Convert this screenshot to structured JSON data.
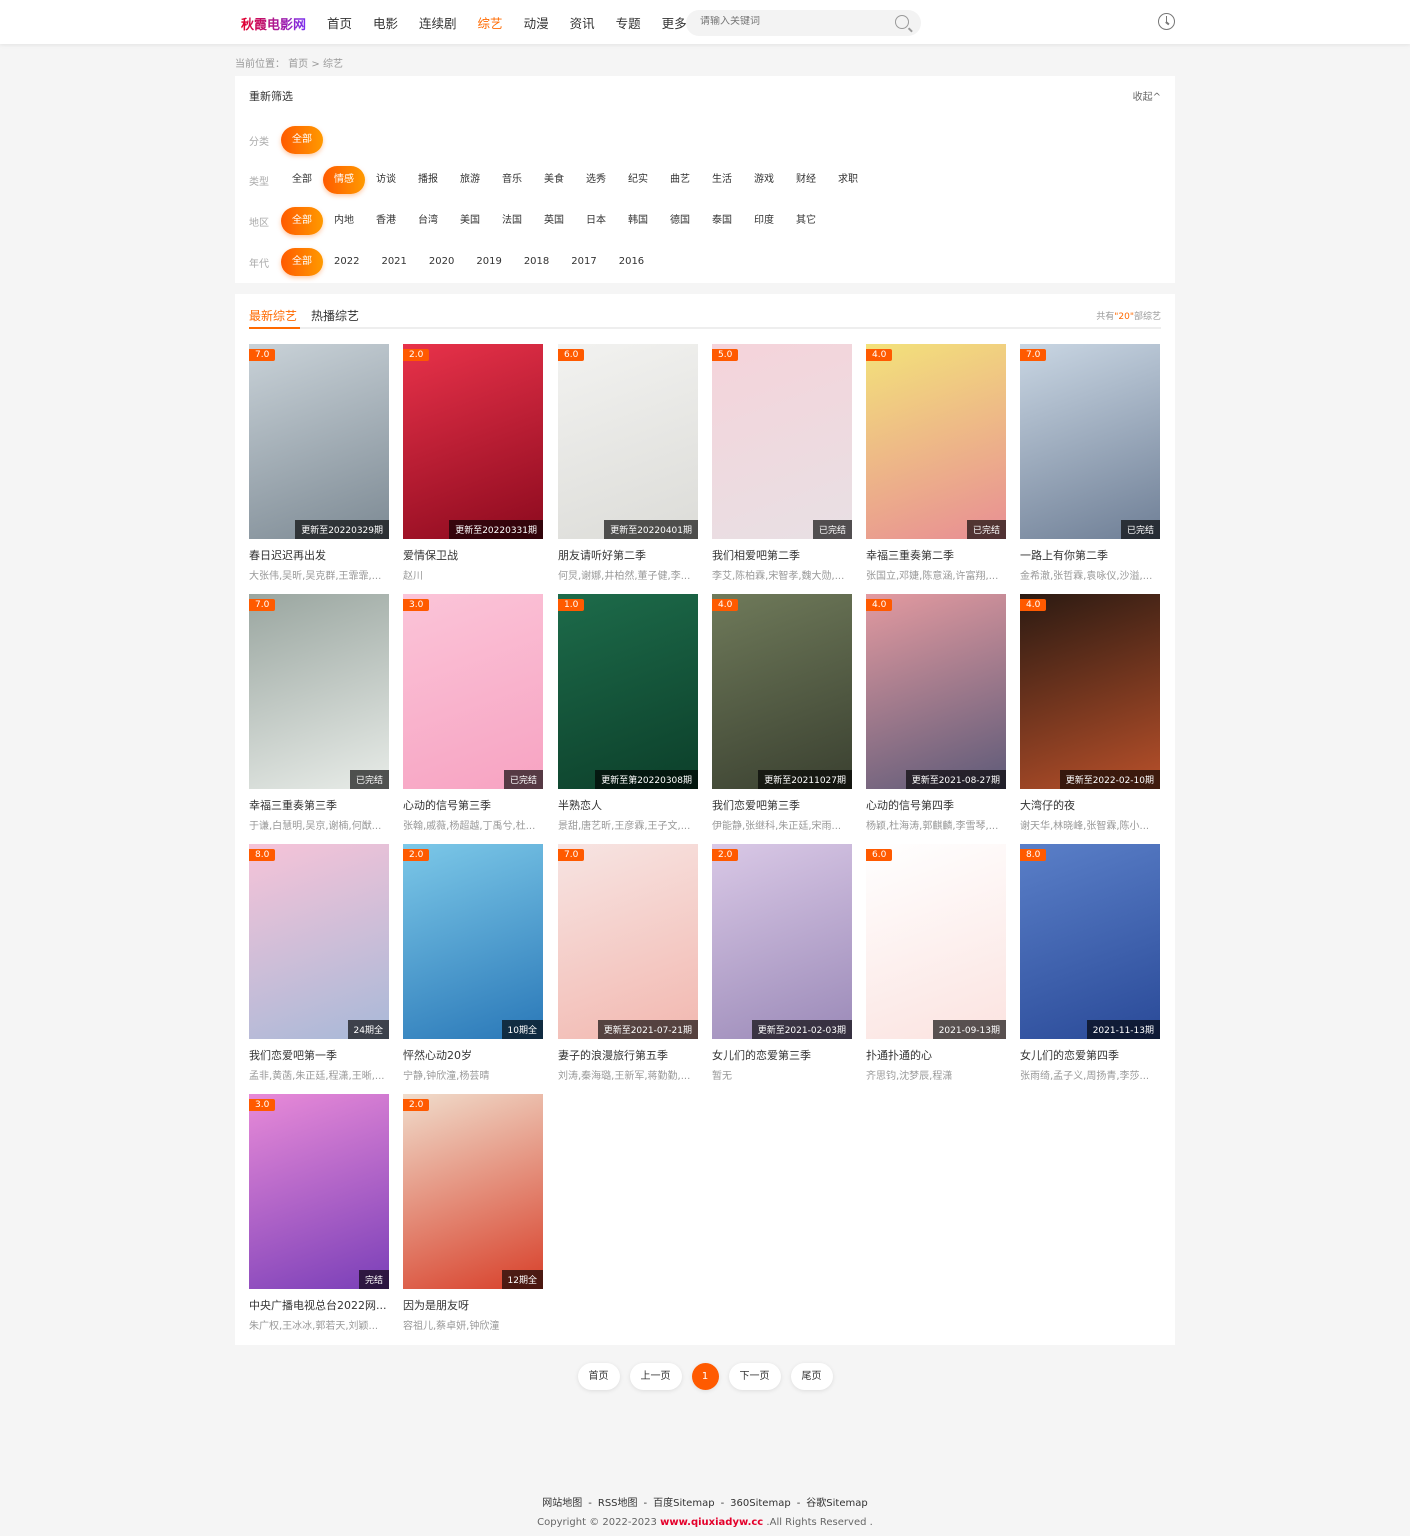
{
  "header": {
    "logo": "秋霞电影网",
    "nav": [
      "首页",
      "电影",
      "连续剧",
      "综艺",
      "动漫",
      "资讯",
      "专题",
      "更多"
    ],
    "active_nav": 3,
    "search_placeholder": "请输入关键词"
  },
  "breadcrumb": {
    "label": "当前位置：",
    "home": "首页",
    "sep": ">",
    "current": "综艺"
  },
  "filter": {
    "title": "重新筛选",
    "collapse": "收起^",
    "rows": [
      {
        "label": "分类",
        "options": [
          "全部"
        ],
        "selected": 0
      },
      {
        "label": "类型",
        "options": [
          "全部",
          "情感",
          "访谈",
          "播报",
          "旅游",
          "音乐",
          "美食",
          "选秀",
          "纪实",
          "曲艺",
          "生活",
          "游戏",
          "财经",
          "求职"
        ],
        "selected": 1
      },
      {
        "label": "地区",
        "options": [
          "全部",
          "内地",
          "香港",
          "台湾",
          "美国",
          "法国",
          "英国",
          "日本",
          "韩国",
          "德国",
          "泰国",
          "印度",
          "其它"
        ],
        "selected": 0
      },
      {
        "label": "年代",
        "options": [
          "全部",
          "2022",
          "2021",
          "2020",
          "2019",
          "2018",
          "2017",
          "2016"
        ],
        "selected": 0
      }
    ]
  },
  "list": {
    "tabs": [
      "最新综艺",
      "热播综艺"
    ],
    "active_tab": 0,
    "count_prefix": "共有",
    "count": "\"20\"",
    "count_suffix": "部综艺",
    "items": [
      {
        "score": "7.0",
        "status": "更新至20220329期",
        "title": "春日迟迟再出发",
        "actors": "大张伟,吴昕,吴克群,王霏霏,...",
        "colors": [
          "#c9d2d8",
          "#7d8a94"
        ]
      },
      {
        "score": "2.0",
        "status": "更新至20220331期",
        "title": "爱情保卫战",
        "actors": "赵川",
        "colors": [
          "#e8324a",
          "#8c0a1e"
        ]
      },
      {
        "score": "6.0",
        "status": "更新至20220401期",
        "title": "朋友请听好第二季",
        "actors": "何炅,谢娜,井柏然,董子健,李...",
        "colors": [
          "#f2f2f0",
          "#dcdcd8"
        ]
      },
      {
        "score": "5.0",
        "status": "已完结",
        "title": "我们相爱吧第二季",
        "actors": "李艾,陈柏霖,宋智孝,魏大勋,...",
        "colors": [
          "#f5d3da",
          "#e8e0e4"
        ]
      },
      {
        "score": "4.0",
        "status": "已完结",
        "title": "幸福三重奏第二季",
        "actors": "张国立,邓婕,陈意涵,许富翔,...",
        "colors": [
          "#f3e27a",
          "#e88e94"
        ]
      },
      {
        "score": "7.0",
        "status": "已完结",
        "title": "一路上有你第二季",
        "actors": "金希澈,张哲霖,袁咏仪,沙溢,...",
        "colors": [
          "#c9d6e3",
          "#6f7f96"
        ]
      },
      {
        "score": "7.0",
        "status": "已完结",
        "title": "幸福三重奏第三季",
        "actors": "于谦,白慧明,吴京,谢楠,何猷...",
        "colors": [
          "#9aa6a0",
          "#e8ece8"
        ]
      },
      {
        "score": "3.0",
        "status": "已完结",
        "title": "心动的信号第三季",
        "actors": "张翰,戚薇,杨超越,丁禹兮,杜...",
        "colors": [
          "#fbc4d8",
          "#f7a3c2"
        ]
      },
      {
        "score": "1.0",
        "status": "更新至第20220308期",
        "title": "半熟恋人",
        "actors": "景甜,唐艺昕,王彦霖,王子文,...",
        "colors": [
          "#1d6b4a",
          "#0c3f2a"
        ]
      },
      {
        "score": "4.0",
        "status": "更新至20211027期",
        "title": "我们恋爱吧第三季",
        "actors": "伊能静,张继科,朱正廷,宋雨...",
        "colors": [
          "#6f7a5a",
          "#3a4030"
        ]
      },
      {
        "score": "4.0",
        "status": "更新至2021-08-27期",
        "title": "心动的信号第四季",
        "actors": "杨颖,杜海涛,郭麒麟,李雪琴,...",
        "colors": [
          "#e39aa0",
          "#5d5a78"
        ]
      },
      {
        "score": "4.0",
        "status": "更新至2022-02-10期",
        "title": "大湾仔的夜",
        "actors": "谢天华,林晓峰,张智霖,陈小...",
        "colors": [
          "#2b1a12",
          "#b8502a"
        ]
      },
      {
        "score": "8.0",
        "status": "24期全",
        "title": "我们恋爱吧第一季",
        "actors": "孟非,黄菡,朱正廷,程潇,王晰,...",
        "colors": [
          "#f6c3d8",
          "#a8b9d8"
        ]
      },
      {
        "score": "2.0",
        "status": "10期全",
        "title": "怦然心动20岁",
        "actors": "宁静,钟欣潼,杨芸晴",
        "colors": [
          "#7cc8e8",
          "#2a78b8"
        ]
      },
      {
        "score": "7.0",
        "status": "更新至2021-07-21期",
        "title": "妻子的浪漫旅行第五季",
        "actors": "刘涛,秦海璐,王新军,蒋勤勤,...",
        "colors": [
          "#f7e4e2",
          "#f2b8b0"
        ]
      },
      {
        "score": "2.0",
        "status": "更新至2021-02-03期",
        "title": "女儿们的恋爱第三季",
        "actors": "暂无",
        "colors": [
          "#d9c8e6",
          "#9b8ab8"
        ]
      },
      {
        "score": "6.0",
        "status": "2021-09-13期",
        "title": "扑通扑通的心",
        "actors": "齐思钧,沈梦辰,程潇",
        "colors": [
          "#ffffff",
          "#fbe3e0"
        ]
      },
      {
        "score": "8.0",
        "status": "2021-11-13期",
        "title": "女儿们的恋爱第四季",
        "actors": "张雨绮,孟子义,周扬青,李莎...",
        "colors": [
          "#5a7fc8",
          "#2a4a98"
        ]
      },
      {
        "score": "3.0",
        "status": "完结",
        "title": "中央广播电视总台2022网...",
        "actors": "朱广权,王冰冰,郭若天,刘颖...",
        "colors": [
          "#e88ad8",
          "#7a3fb8"
        ]
      },
      {
        "score": "2.0",
        "status": "12期全",
        "title": "因为是朋友呀",
        "actors": "容祖儿,蔡卓妍,钟欣潼",
        "colors": [
          "#f0dccb",
          "#d8402a"
        ]
      }
    ]
  },
  "pagination": {
    "first": "首页",
    "prev": "上一页",
    "current": "1",
    "next": "下一页",
    "last": "尾页"
  },
  "footer": {
    "links": [
      "网站地图",
      "RSS地图",
      "百度Sitemap",
      "360Sitemap",
      "谷歌Sitemap"
    ],
    "sep": "-",
    "copy_prefix": "Copyright © 2022-2023",
    "domain": "www.qiuxiadyw.cc",
    "copy_suffix": ".All Rights Reserved ."
  },
  "colors": {
    "accent": "#ff6a00",
    "brand": "#e4002b"
  }
}
